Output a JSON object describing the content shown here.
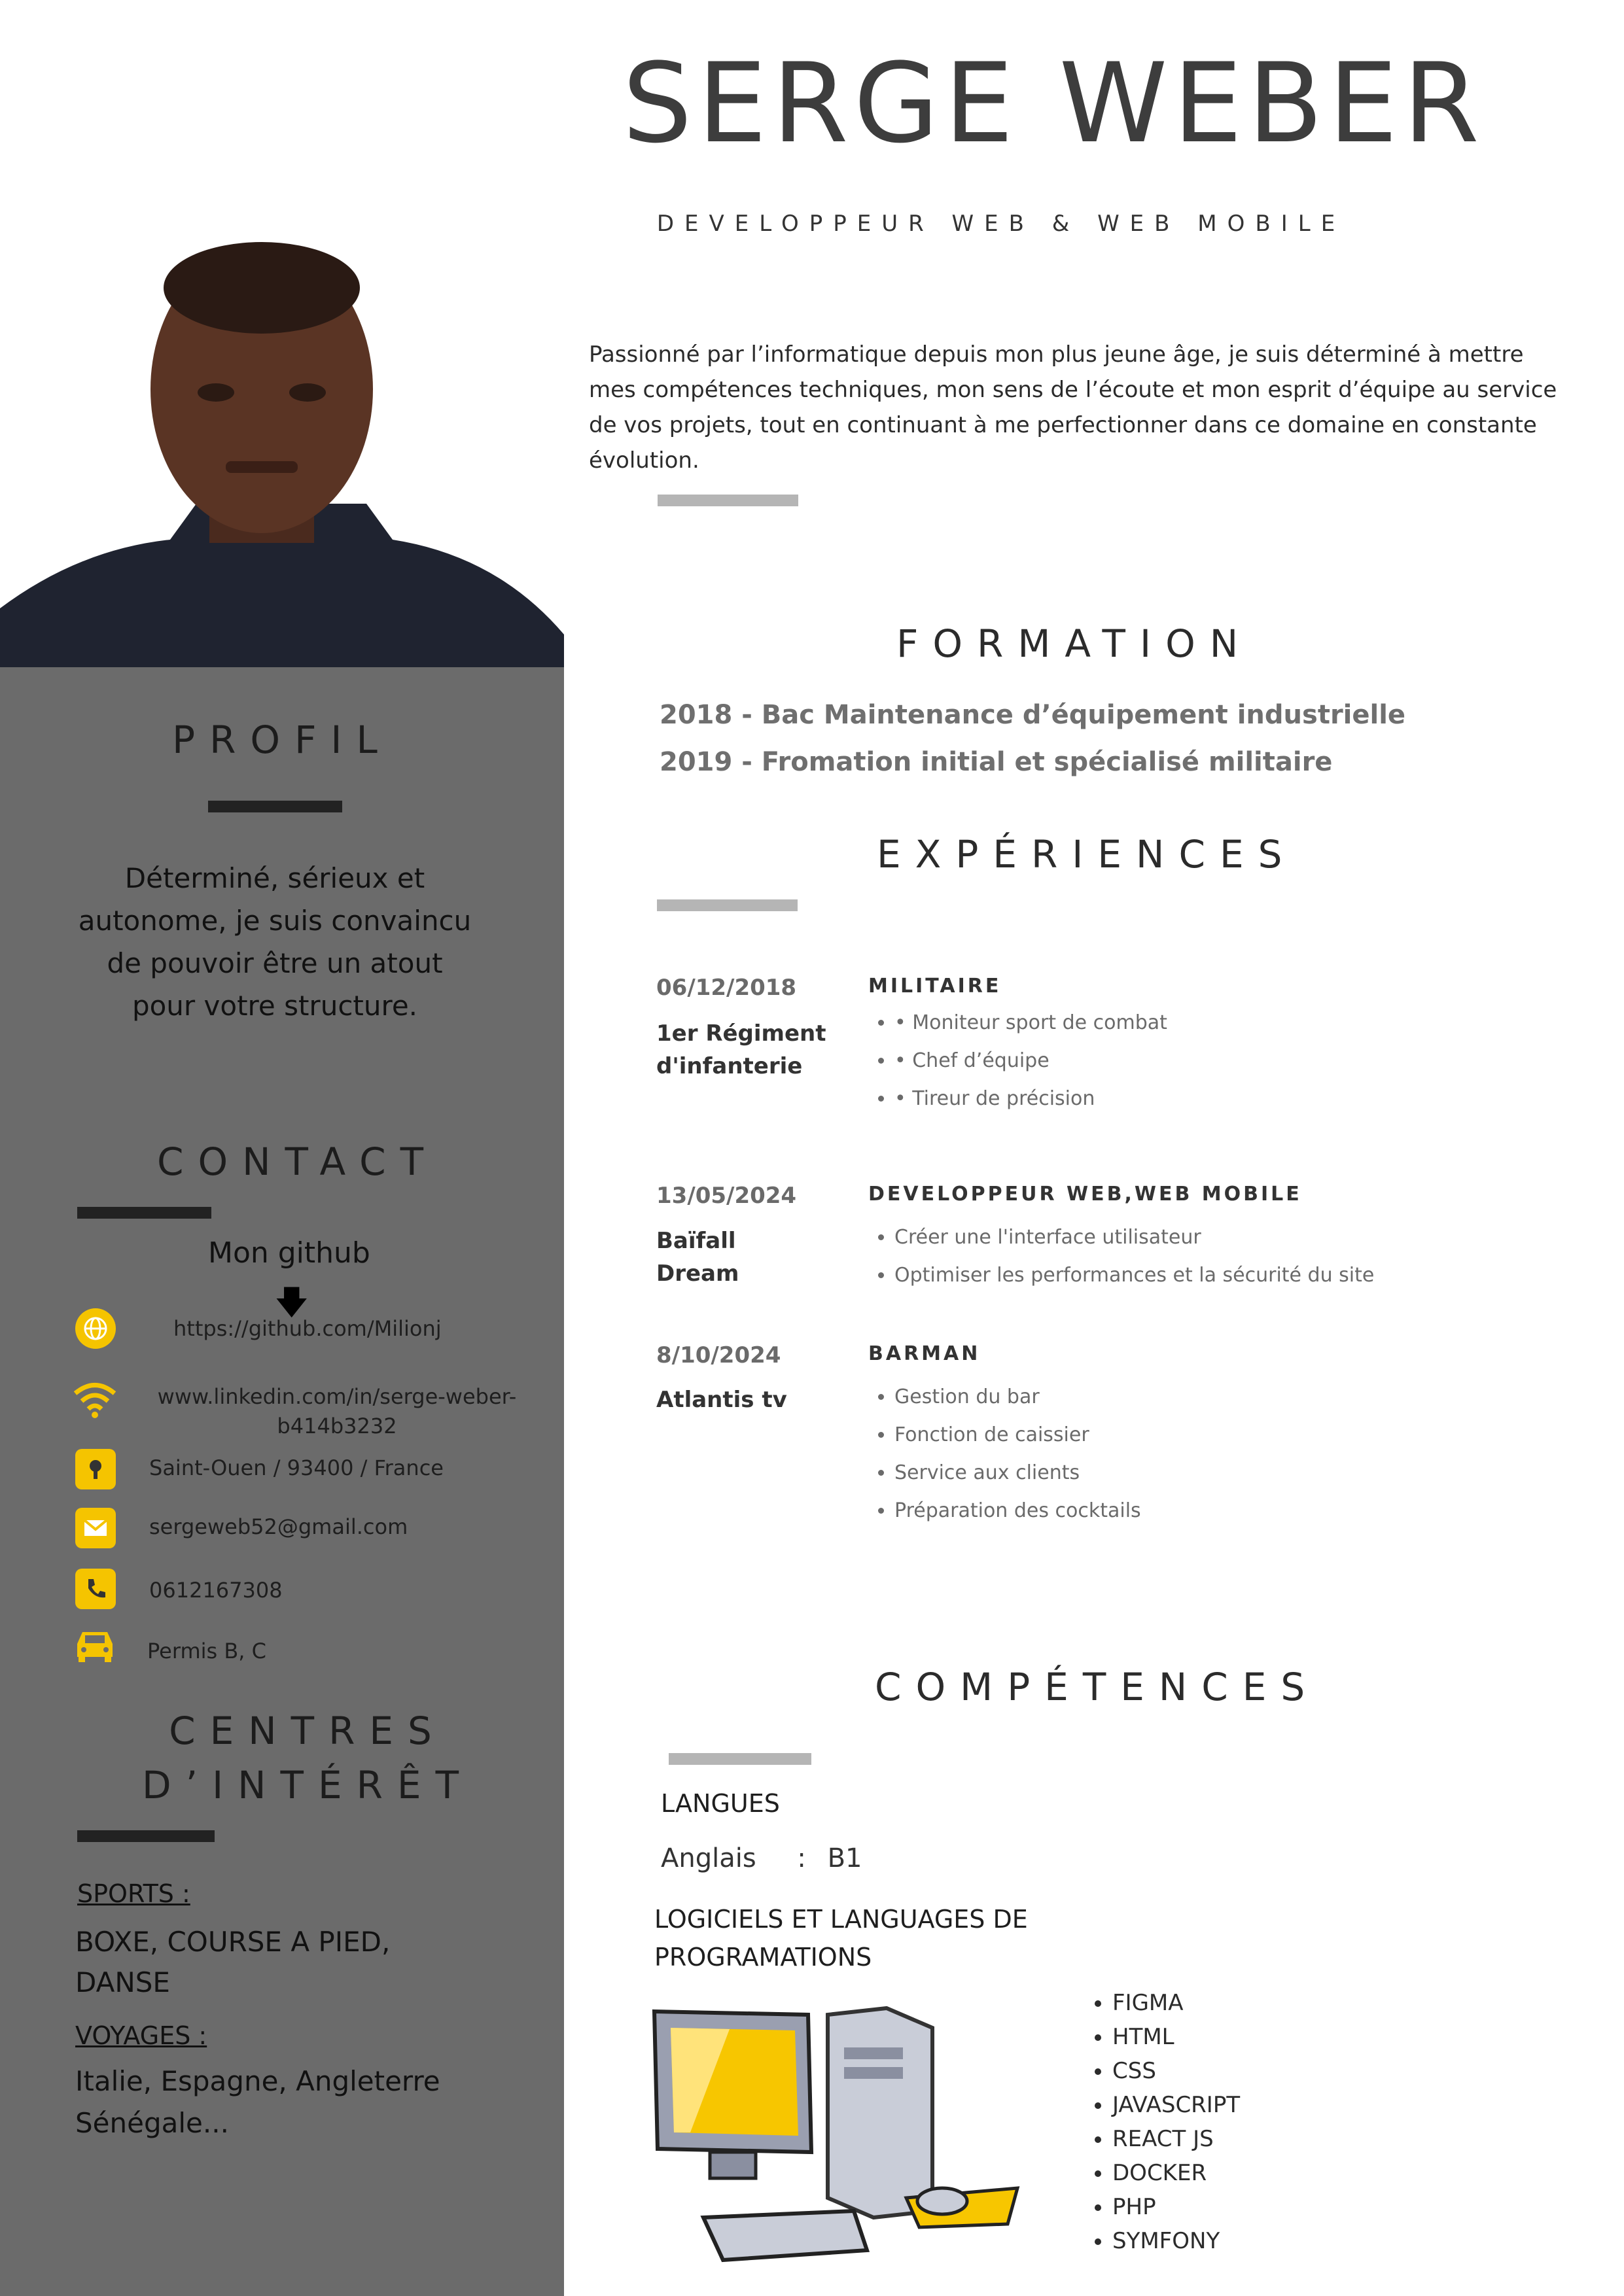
{
  "header": {
    "name": "SERGE WEBER",
    "role": "DEVELOPPEUR WEB & WEB MOBILE",
    "summary": "Passionné par l’informatique depuis mon plus jeune âge, je suis déterminé à mettre mes compétences techniques, mon sens de l’écoute et mon esprit d’équipe au service de vos projets, tout en continuant à me perfectionner dans ce domaine en constante évolution."
  },
  "colors": {
    "sidebar": "#6b6b6b",
    "accent": "#f5c400",
    "title": "#3d3d3d"
  },
  "profil": {
    "title": "PROFIL",
    "text": "Déterminé, sérieux et autonome, je suis convaincu de pouvoir être un atout pour votre structure."
  },
  "contact": {
    "title": "CONTACT",
    "github_label": "Mon github",
    "items": [
      {
        "icon": "globe-icon",
        "text": "https://github.com/Milionj"
      },
      {
        "icon": "wifi-icon",
        "text": "www.linkedin.com/in/serge-weber-b414b3232"
      },
      {
        "icon": "location-pin-icon",
        "text": "Saint-Ouen / 93400 / France"
      },
      {
        "icon": "mail-icon",
        "text": "sergeweb52@gmail.com"
      },
      {
        "icon": "phone-icon",
        "text": "0612167308"
      },
      {
        "icon": "car-icon",
        "text": "Permis B, C"
      }
    ]
  },
  "interests": {
    "title_line1": "CENTRES",
    "title_line2": "D’INTÉRÊT",
    "sports_label": "SPORTS :",
    "sports_text": "BOXE, COURSE A PIED, DANSE",
    "travel_label": "VOYAGES :",
    "travel_text": "Italie, Espagne, Angleterre Sénégale..."
  },
  "formation": {
    "title": "FORMATION",
    "items": [
      "2018 - Bac Maintenance d’équipement industrielle",
      "2019 - Fromation initial et spécialisé militaire"
    ]
  },
  "experiences": {
    "title": "EXPÉRIENCES",
    "items": [
      {
        "date": "06/12/2018",
        "place": "1er Régiment d'infanterie",
        "job": "MILITAIRE",
        "tasks": [
          "• Moniteur sport de combat",
          "• Chef d’équipe",
          "• Tireur de précision"
        ]
      },
      {
        "date": "13/05/2024",
        "place": "Baïfall Dream",
        "job": "DEVELOPPEUR WEB,WEB MOBILE",
        "tasks": [
          "Créer une l'interface utilisateur",
          "Optimiser les performances et la sécurité du site"
        ]
      },
      {
        "date": "8/10/2024",
        "place": "Atlantis tv",
        "job": "BARMAN",
        "tasks": [
          "Gestion du bar",
          "Fonction de caissier",
          "Service aux clients",
          "Préparation des cocktails"
        ]
      }
    ]
  },
  "competences": {
    "title": "COMPÉTENCES",
    "langues_label": "LANGUES",
    "language": "Anglais",
    "level": "B1",
    "software_label": "LOGICIELS ET LANGUAGES DE PROGRAMATIONS",
    "software": [
      "FIGMA",
      "HTML",
      "CSS",
      "JAVASCRIPT",
      "REACT JS",
      "DOCKER",
      "PHP",
      "SYMFONY"
    ]
  }
}
